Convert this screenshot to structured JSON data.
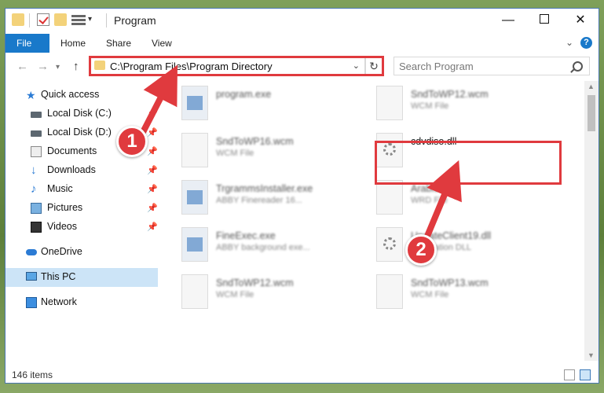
{
  "window": {
    "title": "Program"
  },
  "ribbon": {
    "tabs": [
      "File",
      "Home",
      "Share",
      "View"
    ]
  },
  "nav": {
    "address": "C:\\Program Files\\Program Directory",
    "search_placeholder": "Search Program"
  },
  "sidebar": {
    "items": [
      {
        "label": "Quick access",
        "icon": "star-icon",
        "pinned": false
      },
      {
        "label": "Local Disk (C:)",
        "icon": "drive-icon",
        "pinned": true
      },
      {
        "label": "Local Disk (D:)",
        "icon": "drive-icon",
        "pinned": true
      },
      {
        "label": "Documents",
        "icon": "documents-icon",
        "pinned": true
      },
      {
        "label": "Downloads",
        "icon": "download-icon",
        "pinned": true
      },
      {
        "label": "Music",
        "icon": "music-icon",
        "pinned": true
      },
      {
        "label": "Pictures",
        "icon": "pictures-icon",
        "pinned": true
      },
      {
        "label": "Videos",
        "icon": "videos-icon",
        "pinned": true
      },
      {
        "label": "OneDrive",
        "icon": "cloud-icon",
        "pinned": false
      },
      {
        "label": "This PC",
        "icon": "computer-icon",
        "pinned": false,
        "selected": true
      },
      {
        "label": "Network",
        "icon": "network-icon",
        "pinned": false
      }
    ]
  },
  "files": [
    {
      "name": "program.exe",
      "type": ""
    },
    {
      "name": "SndToWP12.wcm",
      "type": "WCM File"
    },
    {
      "name": "SndToWP16.wcm",
      "type": "WCM File"
    },
    {
      "name": "cdvdiso.dll",
      "type": ""
    },
    {
      "name": "TrgrammsInstaller.exe",
      "type": "ABBY Finereader 16..."
    },
    {
      "name": "Arabic.wcd",
      "type": "WRD File"
    },
    {
      "name": "FineExec.exe",
      "type": "ABBY background exe..."
    },
    {
      "name": "UpdateClient19.dll",
      "type": "Application DLL"
    },
    {
      "name": "SndToWP12.wcm",
      "type": "WCM File"
    },
    {
      "name": "SndToWP13.wcm",
      "type": "WCM File"
    }
  ],
  "status": {
    "item_count": "146 items"
  },
  "annotations": {
    "step1": "1",
    "step2": "2",
    "color": "#e03a3e"
  }
}
